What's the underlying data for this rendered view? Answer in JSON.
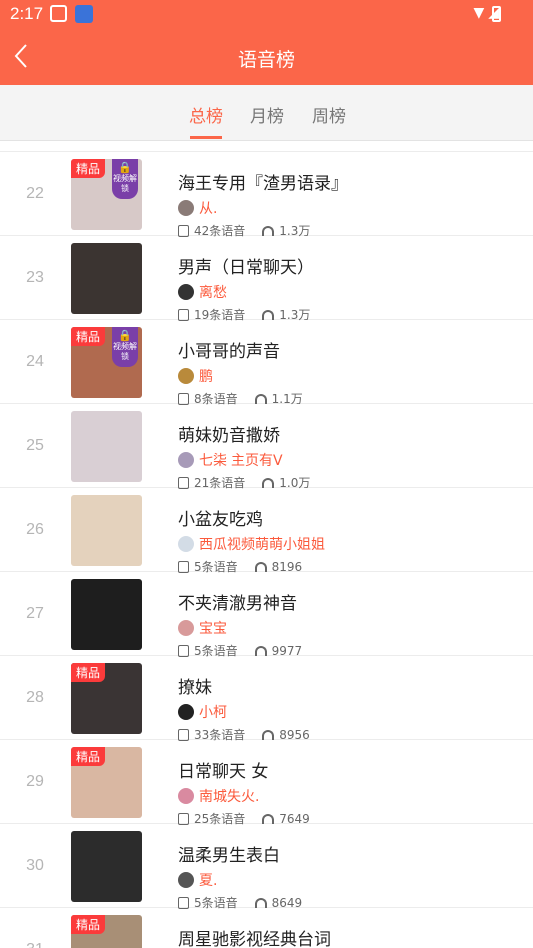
{
  "status": {
    "time": "2:17"
  },
  "header": {
    "title": "语音榜"
  },
  "tabs": [
    {
      "label": "总榜",
      "active": true
    },
    {
      "label": "月榜",
      "active": false
    },
    {
      "label": "周榜",
      "active": false
    }
  ],
  "badge_label": "精品",
  "lock_label": "视频解锁",
  "items": [
    {
      "rank": "22",
      "title": "海王专用『渣男语录』",
      "author": "从.",
      "count": "42条语音",
      "plays": "1.3万",
      "badge": true,
      "lock": true,
      "thumb_color": "#d7c9c8",
      "avatar_color": "#8a7b77"
    },
    {
      "rank": "23",
      "title": "男声（日常聊天）",
      "author": "离愁",
      "count": "19条语音",
      "plays": "1.3万",
      "badge": false,
      "lock": false,
      "thumb_color": "#3b3431",
      "avatar_color": "#333333"
    },
    {
      "rank": "24",
      "title": "小哥哥的声音",
      "author": "鹏",
      "count": "8条语音",
      "plays": "1.1万",
      "badge": true,
      "lock": true,
      "thumb_color": "#b06a4f",
      "avatar_color": "#b98a3b"
    },
    {
      "rank": "25",
      "title": "萌妹奶音撒娇",
      "author": "七柒",
      "author_tag": "主页有V",
      "count": "21条语音",
      "plays": "1.0万",
      "badge": false,
      "lock": false,
      "thumb_color": "#d9cfd4",
      "avatar_color": "#a79ab8"
    },
    {
      "rank": "26",
      "title": "小盆友吃鸡",
      "author": "西瓜视频萌萌小姐姐",
      "count": "5条语音",
      "plays": "8196",
      "badge": false,
      "lock": false,
      "thumb_color": "#e4d2bd",
      "avatar_color": "#d3dce6"
    },
    {
      "rank": "27",
      "title": "不夹清澈男神音",
      "author": "宝宝",
      "count": "5条语音",
      "plays": "9977",
      "badge": false,
      "lock": false,
      "thumb_color": "#1e1e1e",
      "avatar_color": "#d89a9a"
    },
    {
      "rank": "28",
      "title": "撩妹",
      "author": "小柯",
      "count": "33条语音",
      "plays": "8956",
      "badge": true,
      "lock": false,
      "thumb_color": "#3a3434",
      "avatar_color": "#222222"
    },
    {
      "rank": "29",
      "title": "日常聊天 女",
      "author": "南城失火.",
      "count": "25条语音",
      "plays": "7649",
      "badge": true,
      "lock": false,
      "thumb_color": "#d9b7a2",
      "avatar_color": "#d98aa0"
    },
    {
      "rank": "30",
      "title": "温柔男生表白",
      "author": "夏.",
      "count": "5条语音",
      "plays": "8649",
      "badge": false,
      "lock": false,
      "thumb_color": "#2c2c2c",
      "avatar_color": "#555555"
    },
    {
      "rank": "31",
      "title": "周星驰影视经典台词",
      "author": "",
      "count": "",
      "plays": "",
      "badge": true,
      "lock": false,
      "thumb_color": "#a88f76",
      "avatar_color": "#333333"
    }
  ],
  "colors": {
    "accent": "#fb6649",
    "author": "#fb5a3c",
    "badge": "#fb3b3b"
  }
}
